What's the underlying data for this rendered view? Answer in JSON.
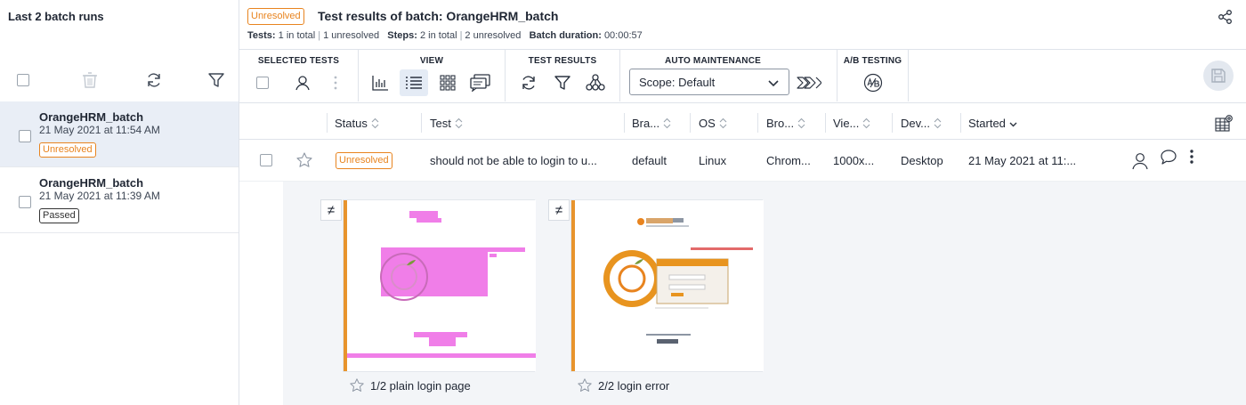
{
  "sidebar": {
    "title": "Last 2 batch runs",
    "runs": [
      {
        "name": "OrangeHRM_batch",
        "date": "21 May 2021 at 11:54 AM",
        "status": "Unresolved"
      },
      {
        "name": "OrangeHRM_batch",
        "date": "21 May 2021 at 11:39 AM",
        "status": "Passed"
      }
    ]
  },
  "header": {
    "status_badge": "Unresolved",
    "title": "Test results of batch: OrangeHRM_batch",
    "tests_label": "Tests:",
    "tests_total": "1 in total",
    "tests_unresolved": "1 unresolved",
    "steps_label": "Steps:",
    "steps_total": "2 in total",
    "steps_unresolved": "2 unresolved",
    "duration_label": "Batch duration:",
    "duration": "00:00:57"
  },
  "toolbar": {
    "groups": [
      "SELECTED TESTS",
      "VIEW",
      "TEST RESULTS",
      "AUTO MAINTENANCE",
      "A/B TESTING"
    ],
    "scope_value": "Scope: Default"
  },
  "table": {
    "columns": [
      "Status",
      "Test",
      "Bra...",
      "OS",
      "Bro...",
      "Vie...",
      "Dev...",
      "Started"
    ],
    "row": {
      "status": "Unresolved",
      "test": "should not be able to login to u...",
      "branch": "default",
      "os": "Linux",
      "browser": "Chrom...",
      "viewport": "1000x...",
      "device": "Desktop",
      "started": "21 May 2021 at 11:..."
    }
  },
  "steps": [
    {
      "label": "1/2 plain login page",
      "diff_symbol": "≠"
    },
    {
      "label": "2/2 login error",
      "diff_symbol": "≠"
    }
  ],
  "colors": {
    "accent_orange": "#e8841f",
    "selected_row": "#e9eef6",
    "diff_magenta": "#f07ee8"
  }
}
